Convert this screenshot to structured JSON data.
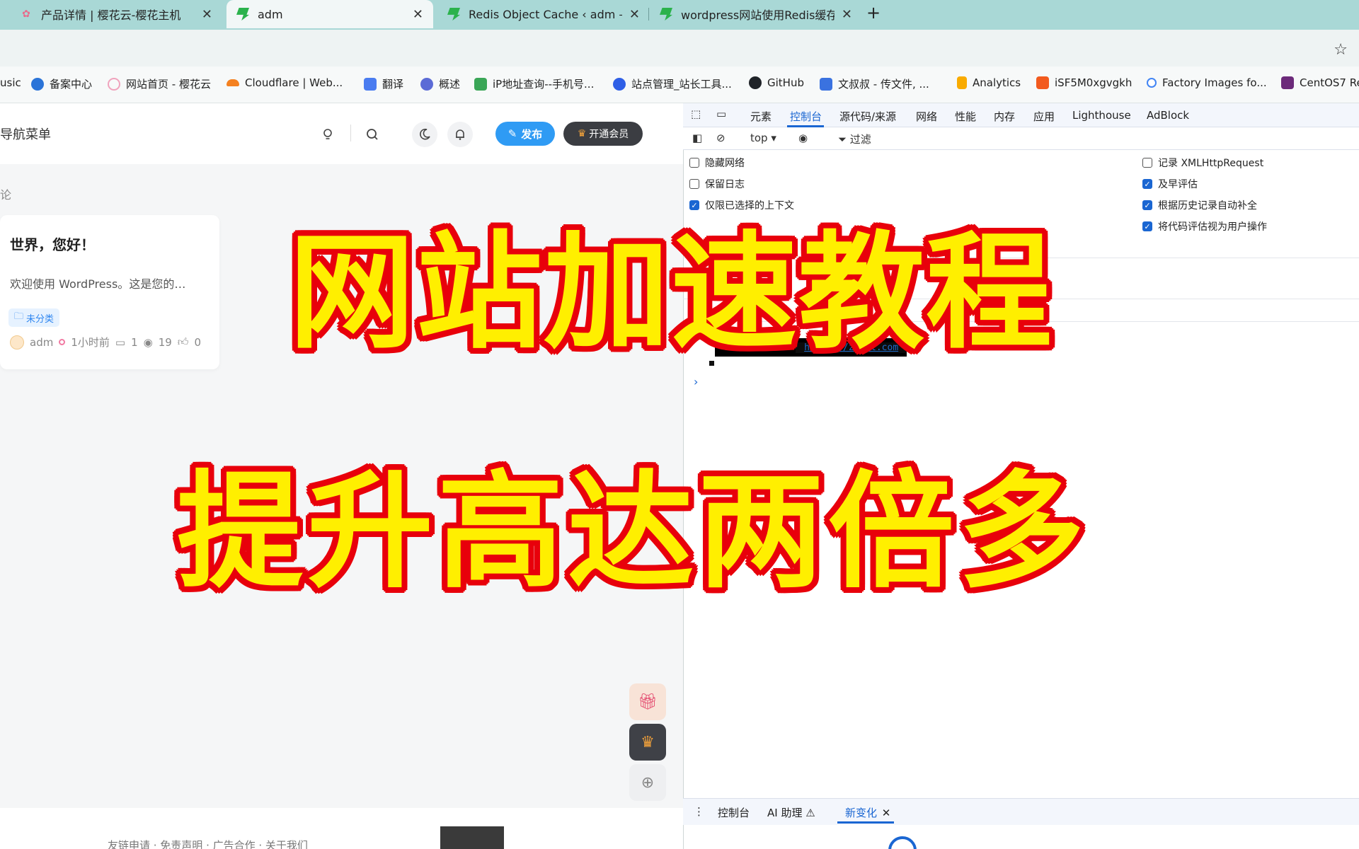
{
  "browser": {
    "tabs": [
      {
        "title": "产品详情 | 樱花云-樱花主机",
        "active": false
      },
      {
        "title": "adm",
        "active": true
      },
      {
        "title": "Redis Object Cache ‹ adm —",
        "active": false
      },
      {
        "title": "wordpress网站使用Redis缓存",
        "active": false
      }
    ],
    "close_glyph": "✕",
    "new_tab_glyph": "+",
    "bookmark_star": "☆",
    "bookmarks": [
      {
        "label": "usic",
        "icon": "music-icon"
      },
      {
        "label": "备案中心",
        "icon": "cube-icon"
      },
      {
        "label": "网站首页 - 樱花云",
        "icon": "cloud-icon"
      },
      {
        "label": "Cloudflare | Web...",
        "icon": "cloudflare-icon"
      },
      {
        "label": "翻译",
        "icon": "translate-icon"
      },
      {
        "label": "概述",
        "icon": "overview-icon"
      },
      {
        "label": "iP地址查询--手机号...",
        "icon": "ip-icon"
      },
      {
        "label": "站点管理_站长工具...",
        "icon": "baidu-icon"
      },
      {
        "label": "GitHub",
        "icon": "github-icon"
      },
      {
        "label": "文叔叔 - 传文件, ...",
        "icon": "wenshushu-icon"
      },
      {
        "label": "Analytics",
        "icon": "analytics-icon"
      },
      {
        "label": "iSF5M0xgvgkh",
        "icon": "flag-icon"
      },
      {
        "label": "Factory Images fo...",
        "icon": "google-icon"
      },
      {
        "label": "CentOS7 Re",
        "icon": "centos-icon"
      }
    ]
  },
  "site": {
    "nav_label": "导航菜单",
    "publish_label": "发布",
    "vip_label": "开通会员",
    "crumb": "论",
    "post": {
      "title": "世界，您好！",
      "excerpt": "欢迎使用 WordPress。这是您的…",
      "category": "未分类",
      "author": "adm",
      "time": "1小时前",
      "comments": "1",
      "views": "19",
      "likes": "0"
    },
    "footer_links": "友链申请 · 免责声明 · 广告合作 · 关于我们"
  },
  "devtools": {
    "tabs": [
      "元素",
      "控制台",
      "源代码/来源",
      "网络",
      "性能",
      "内存",
      "应用",
      "Lighthouse",
      "AdBlock"
    ],
    "active_tab": "控制台",
    "context": "top ▾",
    "filter_label": "过滤",
    "options_left": [
      {
        "label": "隐藏网络",
        "checked": false
      },
      {
        "label": "保留日志",
        "checked": false
      },
      {
        "label": "仅限已选择的上下文",
        "checked": true
      }
    ],
    "options_right": [
      {
        "label": "记录 XMLHttpRequest",
        "checked": false
      },
      {
        "label": "及早评估",
        "checked": true
      },
      {
        "label": "根据历史记录自动补全",
        "checked": true
      },
      {
        "label": "将代码评估视为用户操作",
        "checked": true
      }
    ],
    "console_badge": {
      "name": "Zibll Theme",
      "url": "https://zibll.com"
    },
    "prompt": "›",
    "drawer_tabs": [
      "控制台",
      "AI 助理 ⚠",
      "新变化"
    ],
    "drawer_active": "新变化"
  },
  "overlay": {
    "line1": "网站加速教程",
    "line2": "提升高达两倍多"
  },
  "colors": {
    "overlay_fill": "#ffef00",
    "overlay_stroke": "#e8000b",
    "accent": "#1a66d2",
    "publish": "#2f9bf4",
    "tabstrip": "#a9d8d6"
  }
}
